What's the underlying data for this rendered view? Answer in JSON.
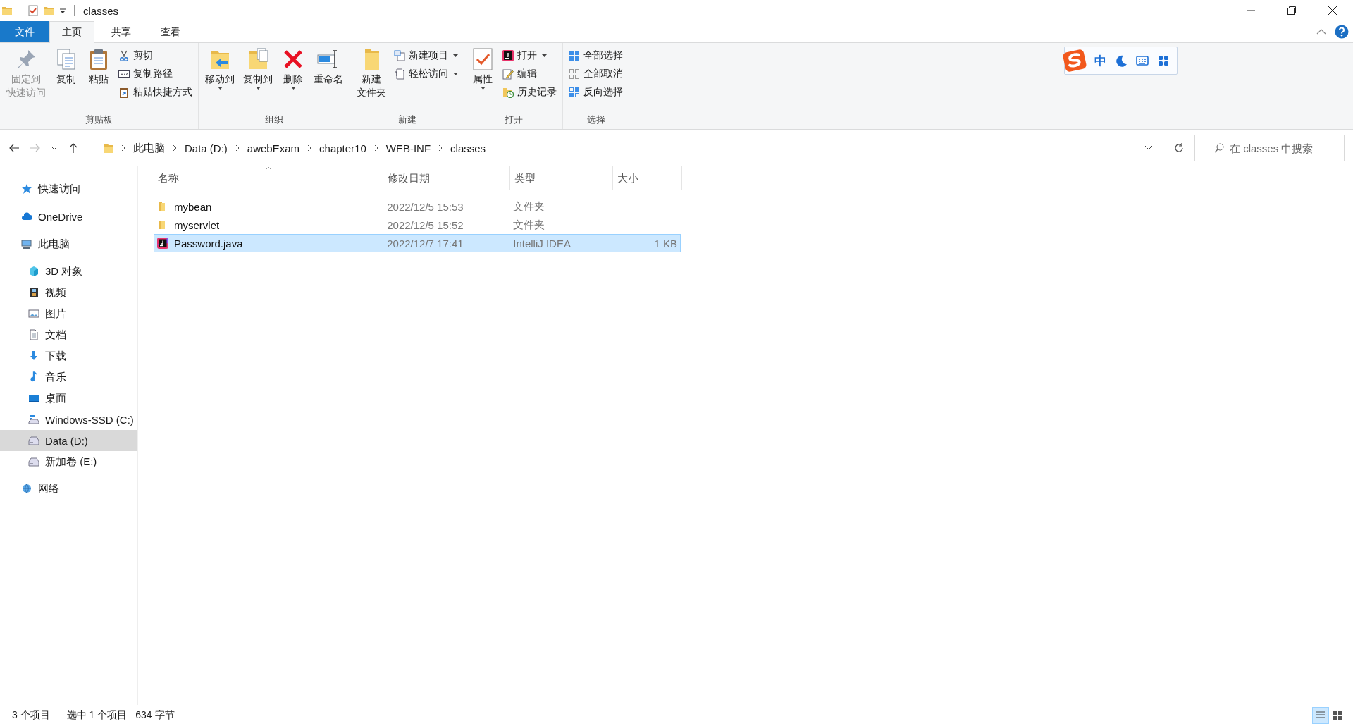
{
  "title_bar": {
    "title": "classes"
  },
  "tabs": [
    {
      "label": "文件",
      "kind": "file",
      "selected": false
    },
    {
      "label": "主页",
      "kind": "tab",
      "selected": true
    },
    {
      "label": "共享",
      "kind": "tab",
      "selected": false
    },
    {
      "label": "查看",
      "kind": "tab",
      "selected": false
    }
  ],
  "ribbon": {
    "groups": [
      {
        "label": "剪贴板",
        "items": [
          {
            "lines": [
              "固定到",
              "快速访问"
            ],
            "kind": "large",
            "disabled": true,
            "dropdown": false
          },
          {
            "label": "复制",
            "kind": "large",
            "disabled": false,
            "dropdown": false
          },
          {
            "label": "粘贴",
            "kind": "large",
            "disabled": false,
            "dropdown": false
          },
          {
            "label": "剪切",
            "kind": "small",
            "disabled": false,
            "dropdown": false
          },
          {
            "label": "复制路径",
            "kind": "small",
            "disabled": false,
            "dropdown": false
          },
          {
            "label": "粘贴快捷方式",
            "kind": "small",
            "disabled": false,
            "dropdown": false
          }
        ]
      },
      {
        "label": "组织",
        "items": [
          {
            "label": "移动到",
            "kind": "large",
            "disabled": false,
            "dropdown": true
          },
          {
            "label": "复制到",
            "kind": "large",
            "disabled": false,
            "dropdown": true
          },
          {
            "label": "删除",
            "kind": "large",
            "disabled": false,
            "dropdown": true
          },
          {
            "label": "重命名",
            "kind": "large",
            "disabled": false,
            "dropdown": false
          }
        ]
      },
      {
        "label": "新建",
        "items": [
          {
            "lines": [
              "新建",
              "文件夹"
            ],
            "kind": "large",
            "disabled": false,
            "dropdown": false
          },
          {
            "label": "新建项目",
            "kind": "small",
            "disabled": false,
            "dropdown": true
          },
          {
            "label": "轻松访问",
            "kind": "small",
            "disabled": false,
            "dropdown": true
          }
        ]
      },
      {
        "label": "打开",
        "items": [
          {
            "label": "属性",
            "kind": "large",
            "disabled": false,
            "dropdown": true
          },
          {
            "label": "打开",
            "kind": "small",
            "disabled": false,
            "dropdown": true
          },
          {
            "label": "编辑",
            "kind": "small",
            "disabled": false,
            "dropdown": false
          },
          {
            "label": "历史记录",
            "kind": "small",
            "disabled": false,
            "dropdown": false
          }
        ]
      },
      {
        "label": "选择",
        "items": [
          {
            "label": "全部选择",
            "kind": "small",
            "disabled": false,
            "dropdown": false
          },
          {
            "label": "全部取消",
            "kind": "small",
            "disabled": false,
            "dropdown": false
          },
          {
            "label": "反向选择",
            "kind": "small",
            "disabled": false,
            "dropdown": false
          }
        ]
      }
    ]
  },
  "ime_toolbar": {
    "mode": "中"
  },
  "address_bar": {
    "path": [
      "此电脑",
      "Data (D:)",
      "awebExam",
      "chapter10",
      "WEB-INF",
      "classes"
    ],
    "search": {
      "placeholder": "在 classes 中搜索"
    }
  },
  "sidebar": {
    "items": [
      {
        "label": "快速访问",
        "selected": false
      },
      {
        "label": "OneDrive",
        "selected": false
      },
      {
        "label": "此电脑",
        "selected": false,
        "children": [
          {
            "label": "3D 对象",
            "selected": false
          },
          {
            "label": "视频",
            "selected": false
          },
          {
            "label": "图片",
            "selected": false
          },
          {
            "label": "文档",
            "selected": false
          },
          {
            "label": "下载",
            "selected": false
          },
          {
            "label": "音乐",
            "selected": false
          },
          {
            "label": "桌面",
            "selected": false
          },
          {
            "label": "Windows-SSD (C:)",
            "selected": false
          },
          {
            "label": "Data (D:)",
            "selected": true
          },
          {
            "label": "新加卷 (E:)",
            "selected": false
          }
        ]
      },
      {
        "label": "网络",
        "selected": false
      }
    ]
  },
  "table": {
    "columns": [
      {
        "label": "名称",
        "sorted": true
      },
      {
        "label": "修改日期",
        "sorted": false
      },
      {
        "label": "类型",
        "sorted": false
      },
      {
        "label": "大小",
        "sorted": false
      }
    ],
    "rows": [
      {
        "kind": "folder",
        "name": "mybean",
        "date": "2022/12/5 15:53",
        "type": "文件夹",
        "selected": false
      },
      {
        "kind": "folder",
        "name": "myservlet",
        "date": "2022/12/5 15:52",
        "type": "文件夹",
        "selected": false
      },
      {
        "kind": "file",
        "name": "Password.java",
        "date": "2022/12/7 17:41",
        "type": "IntelliJ IDEA",
        "size": "1 KB",
        "selected": true
      }
    ]
  },
  "status_bar": {
    "item_count": "3 个项目",
    "selection": "选中 1 个项目",
    "selection_size": "634 字节"
  },
  "view_buttons": [
    {
      "kind": "details",
      "selected": true
    },
    {
      "kind": "tiles",
      "selected": false
    }
  ]
}
